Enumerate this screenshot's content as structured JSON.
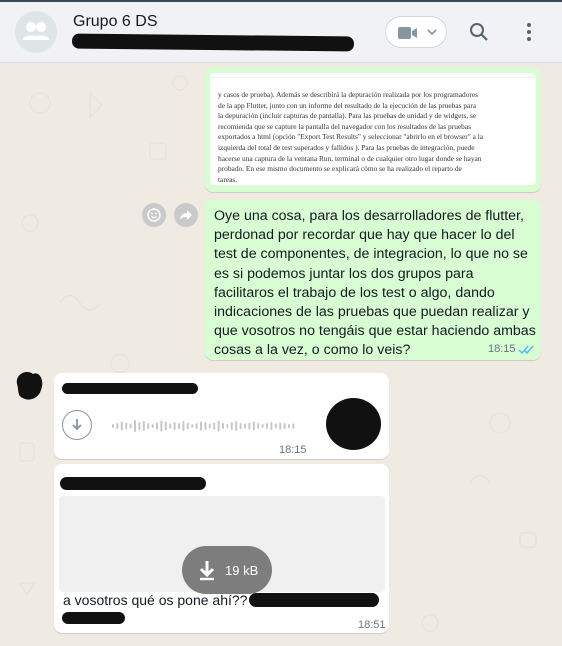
{
  "header": {
    "title": "Grupo 6 DS",
    "icons": [
      "group-avatar-icon",
      "video-call-icon",
      "chevron-down-icon",
      "search-icon",
      "menu-icon"
    ]
  },
  "messages": [
    {
      "type": "document_image",
      "lines": [
        "y casos de prueba). Además se describirá la depuración realizada por los programadores",
        "de la app Flutter, junto con un informe del resultado de la ejecución de las pruebas para",
        "la depuración (incluir capturas de pantalla). Para las pruebas de unidad y de widgets, se",
        "recomienda que se capture la pantalla del navegador con los resultados de las pruebas",
        "exportados a html (opción \"Export Test Results\" y seleccionar \"abrirlo en el browser\" a la",
        "izquierda del total de test superados y fallidos ). Para las pruebas de integración, puede",
        "hacerse una captura de la ventana Run, terminal o de cualquier otro lugar donde se hayan",
        "probado. En ese mismo documento se explicará cómo se ha realizado el reparto de",
        "tareas."
      ]
    },
    {
      "type": "outgoing_text",
      "text": "Oye una cosa, para los desarrolladores de flutter, perdonad por recordar que hay que hacer lo del test de componentes, de integracion, lo que no se es si podemos juntar los dos grupos para facilitaros el trabajo de los test o algo, dando indicaciones de las pruebas que puedan realizar y que vosotros no tengáis que estar haciendo ambas cosas a la vez, o como lo veis?",
      "time": "18:15",
      "status": "read"
    },
    {
      "type": "incoming_voice",
      "time": "18:15"
    },
    {
      "type": "incoming_file",
      "file_size": "19 kB",
      "caption": "a vosotros qué os pone ahí??",
      "time": "18:51"
    }
  ],
  "colors": {
    "outgoing_bubble": "#d9fdd3",
    "incoming_bubble": "#ffffff",
    "chat_background": "#efeae2",
    "read_ticks": "#53bdeb"
  }
}
